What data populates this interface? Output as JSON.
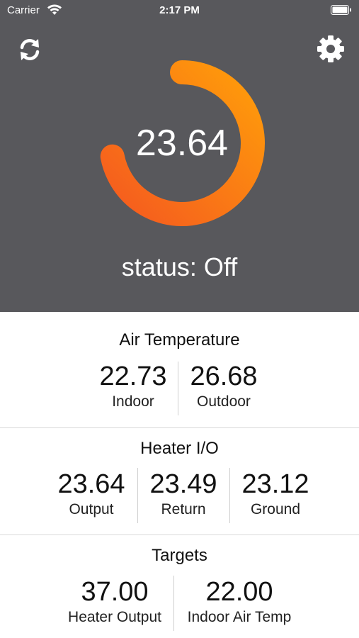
{
  "status_bar": {
    "carrier": "Carrier",
    "time": "2:17 PM"
  },
  "header": {
    "refresh_icon": "refresh-icon",
    "settings_icon": "gear-icon"
  },
  "gauge": {
    "value": "23.64",
    "status": "status: Off",
    "fill_fraction": 0.72,
    "colors": {
      "start": "#f55a1f",
      "end": "#ff9d0a",
      "track": "#58585c"
    }
  },
  "air_temperature": {
    "title": "Air Temperature",
    "items": [
      {
        "value": "22.73",
        "label": "Indoor"
      },
      {
        "value": "26.68",
        "label": "Outdoor"
      }
    ]
  },
  "heater_io": {
    "title": "Heater I/O",
    "items": [
      {
        "value": "23.64",
        "label": "Output"
      },
      {
        "value": "23.49",
        "label": "Return"
      },
      {
        "value": "23.12",
        "label": "Ground"
      }
    ]
  },
  "targets": {
    "title": "Targets",
    "items": [
      {
        "value": "37.00",
        "label": "Heater Output"
      },
      {
        "value": "22.00",
        "label": "Indoor Air Temp"
      }
    ]
  }
}
